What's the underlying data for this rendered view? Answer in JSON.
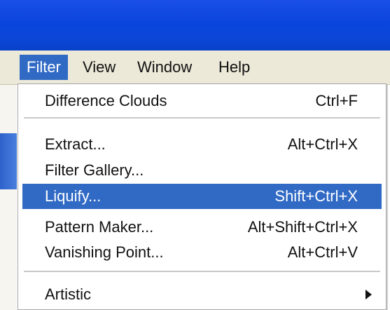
{
  "menubar": {
    "items": [
      {
        "label": "Filter",
        "active": true
      },
      {
        "label": "View",
        "active": false
      },
      {
        "label": "Window",
        "active": false
      },
      {
        "label": "Help",
        "active": false
      }
    ]
  },
  "dropdown": {
    "items": [
      {
        "label": "Difference Clouds",
        "shortcut": "Ctrl+F"
      },
      {
        "label": "Extract...",
        "shortcut": "Alt+Ctrl+X"
      },
      {
        "label": "Filter Gallery...",
        "shortcut": ""
      },
      {
        "label": "Liquify...",
        "shortcut": "Shift+Ctrl+X",
        "highlighted": true
      },
      {
        "label": "Pattern Maker...",
        "shortcut": "Alt+Shift+Ctrl+X"
      },
      {
        "label": "Vanishing Point...",
        "shortcut": "Alt+Ctrl+V"
      },
      {
        "label": "Artistic",
        "shortcut": "",
        "has_submenu": true
      }
    ]
  },
  "colors": {
    "titlebar_blue": "#0a45dc",
    "menubar_bg": "#ece9d8",
    "highlight": "#316ac5",
    "menu_bg": "#ffffff",
    "text": "#111111",
    "highlight_text": "#ffffff"
  },
  "icons": {
    "submenu_arrow": "right-triangle-arrow"
  }
}
